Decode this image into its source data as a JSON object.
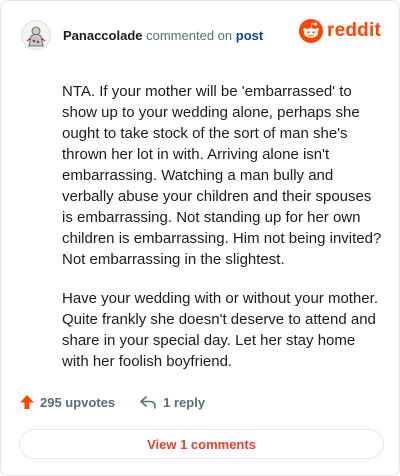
{
  "header": {
    "username": "Panaccolade",
    "action_text": "commented on",
    "post_link": "post",
    "brand_name": "reddit",
    "brand_color": "#ff4500"
  },
  "comment": {
    "paragraphs": [
      "NTA. If your mother will be 'embarrassed' to show up to your wedding alone, perhaps she ought to take stock of the sort of man she's thrown her lot in with. Arriving alone isn't embarrassing. Watching a man bully and verbally abuse your children and their spouses is embarrassing. Not standing up for her own children is embarrassing. Him not being invited? Not embarrassing in the slightest.",
      "Have your wedding with or without your mother. Quite frankly she doesn't deserve to attend and share in your special day. Let her stay home with her foolish boyfriend."
    ]
  },
  "actions": {
    "upvotes_label": "295 upvotes",
    "replies_label": "1 reply",
    "upvote_icon": "upvote-arrow-icon",
    "reply_icon": "reply-arrow-icon"
  },
  "footer": {
    "view_comments_label": "View 1 comments"
  }
}
